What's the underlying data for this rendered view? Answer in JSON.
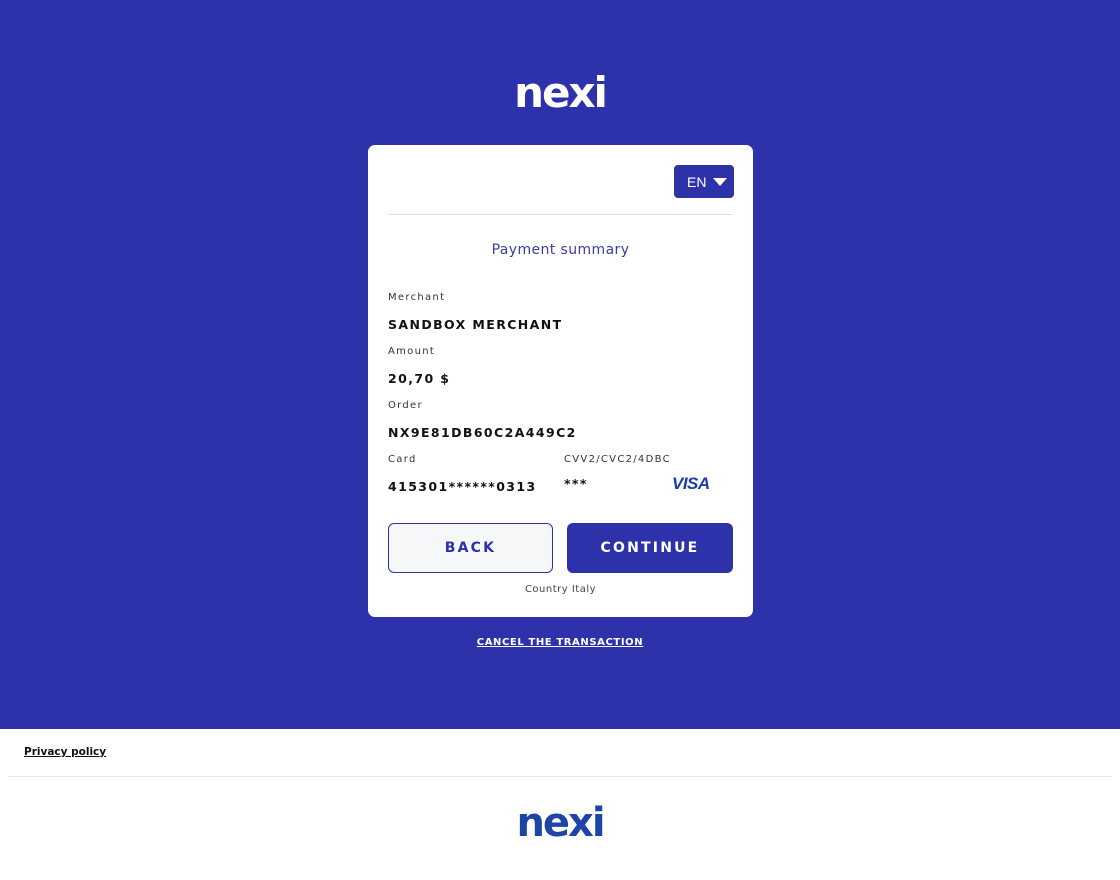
{
  "brand": {
    "logo_text": "nexi"
  },
  "language": {
    "selected": "EN"
  },
  "summary": {
    "title": "Payment summary",
    "merchant_label": "Merchant",
    "merchant_value": "SANDBOX MERCHANT",
    "amount_label": "Amount",
    "amount_value": "20,70 $",
    "order_label": "Order",
    "order_value": "NX9E81DB60C2A449C2",
    "card_label": "Card",
    "card_value": "415301******0313",
    "cvv_label": "CVV2/CVC2/4DBC",
    "cvv_value": "***",
    "card_brand": "VISA"
  },
  "actions": {
    "back_label": "BACK",
    "continue_label": "CONTINUE"
  },
  "country_text": "Country Italy",
  "cancel_label": "CANCEL THE TRANSACTION",
  "footer": {
    "privacy_label": "Privacy policy"
  },
  "colors": {
    "primary": "#2d32aa",
    "logo_footer": "#1d45a6"
  }
}
